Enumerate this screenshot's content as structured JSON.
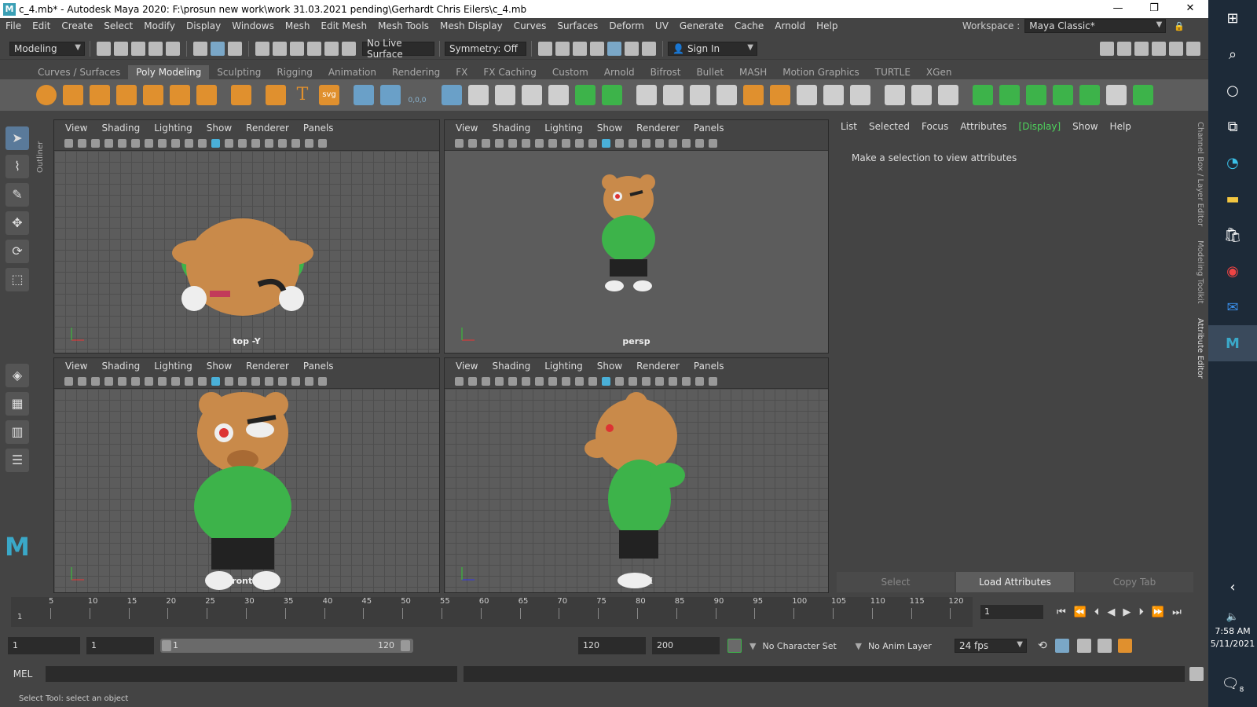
{
  "window": {
    "title": "c_4.mb* - Autodesk Maya 2020: F:\\prosun new work\\work 31.03.2021 pending\\Gerhardt Chris Eilers\\c_4.mb",
    "logo": "M",
    "minimize": "—",
    "maximize": "❐",
    "close": "✕"
  },
  "menu": [
    "File",
    "Edit",
    "Create",
    "Select",
    "Modify",
    "Display",
    "Windows",
    "Mesh",
    "Edit Mesh",
    "Mesh Tools",
    "Mesh Display",
    "Curves",
    "Surfaces",
    "Deform",
    "UV",
    "Generate",
    "Cache",
    "Arnold",
    "Help"
  ],
  "workspace": {
    "label": "Workspace :",
    "value": "Maya Classic*"
  },
  "status": {
    "mode": "Modeling",
    "live_surface": "No Live Surface",
    "symmetry": "Symmetry: Off",
    "sign_in": "Sign In"
  },
  "shelf_tabs": [
    "Curves / Surfaces",
    "Poly Modeling",
    "Sculpting",
    "Rigging",
    "Animation",
    "Rendering",
    "FX",
    "FX Caching",
    "Custom",
    "Arnold",
    "Bifrost",
    "Bullet",
    "MASH",
    "Motion Graphics",
    "TURTLE",
    "XGen"
  ],
  "active_shelf_tab": "Poly Modeling",
  "shelf_text_icons": {
    "type": "T",
    "svg": "svg",
    "coords": "0,0,0"
  },
  "viewport_menu": [
    "View",
    "Shading",
    "Lighting",
    "Show",
    "Renderer",
    "Panels"
  ],
  "viewports": [
    {
      "camera": "top -Y"
    },
    {
      "camera": "persp"
    },
    {
      "camera": "front -Z"
    },
    {
      "camera": "side -X"
    }
  ],
  "outliner_tab": "Outliner",
  "attribute_editor": {
    "menu": [
      "List",
      "Selected",
      "Focus",
      "Attributes",
      "[Display]",
      "Show",
      "Help"
    ],
    "message": "Make a selection to view attributes",
    "buttons": [
      "Select",
      "Load Attributes",
      "Copy Tab"
    ]
  },
  "side_tabs": [
    "Channel Box / Layer Editor",
    "Modeling Toolkit",
    "Attribute Editor"
  ],
  "time_slider": {
    "ticks": [
      "5",
      "10",
      "15",
      "20",
      "25",
      "30",
      "35",
      "40",
      "45",
      "50",
      "55",
      "60",
      "65",
      "70",
      "75",
      "80",
      "85",
      "90",
      "95",
      "100",
      "105",
      "110",
      "115",
      "120"
    ],
    "current_frame": "1",
    "current_field": "1"
  },
  "range": {
    "start": "1",
    "playback_start": "1",
    "slider_start": "1",
    "slider_end": "120",
    "playback_end": "120",
    "end": "200",
    "character_set": "No Character Set",
    "anim_layer": "No Anim Layer",
    "fps": "24 fps"
  },
  "mel": {
    "label": "MEL"
  },
  "help_line": "Select Tool: select an object",
  "taskbar": {
    "time": "7:58 AM",
    "date": "5/11/2021",
    "notifications": "8"
  },
  "colors": {
    "accent_green": "#4ed45c",
    "hoodie": "#3db34a",
    "bear": "#c98a4a",
    "bg": "#444444"
  }
}
